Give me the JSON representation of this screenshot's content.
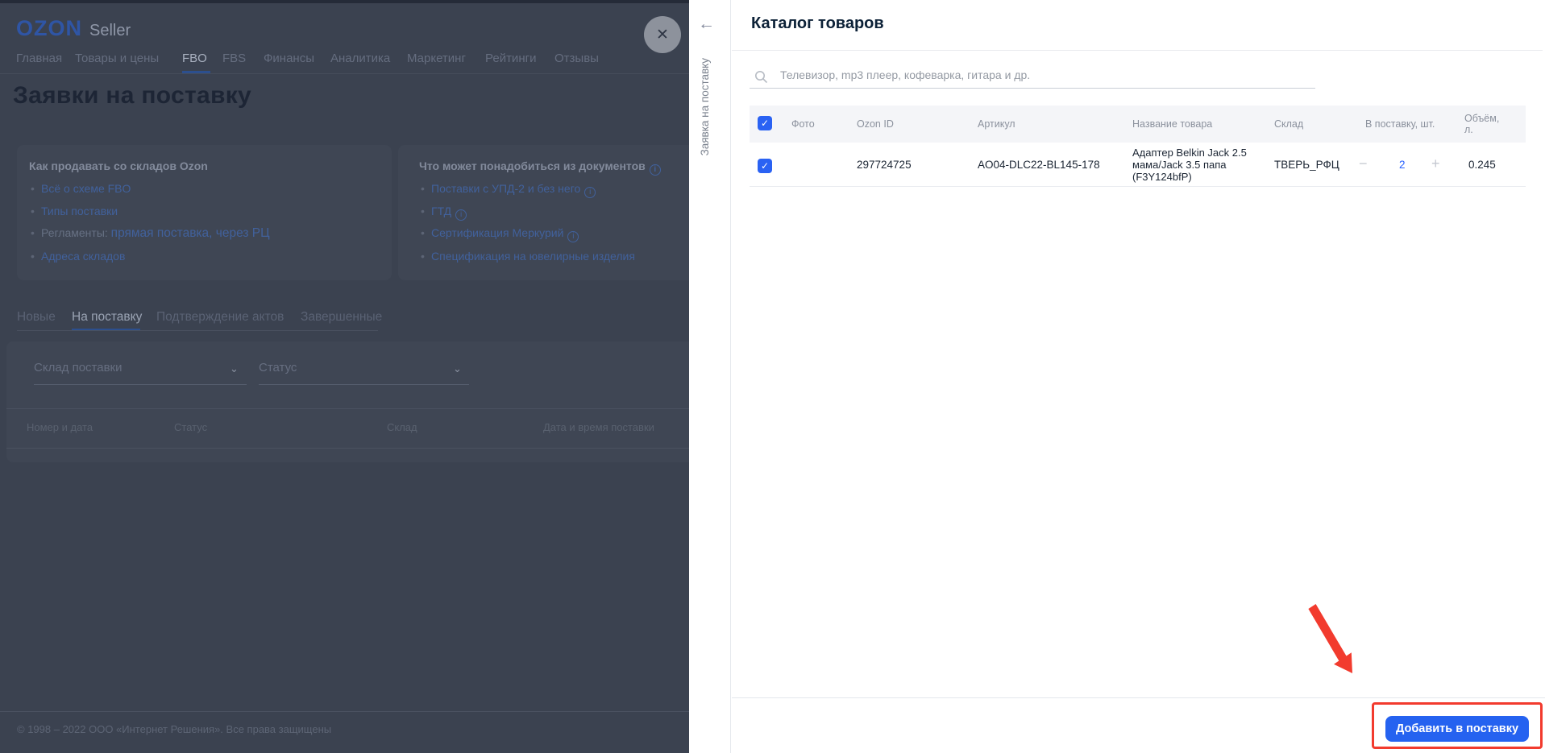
{
  "brand": {
    "ozon": "OZON",
    "seller": "Seller"
  },
  "nav": {
    "items": [
      {
        "label": "Главная"
      },
      {
        "label": "Товары и цены"
      },
      {
        "label": "FBO"
      },
      {
        "label": "FBS"
      },
      {
        "label": "Финансы"
      },
      {
        "label": "Аналитика"
      },
      {
        "label": "Маркетинг"
      },
      {
        "label": "Рейтинги"
      },
      {
        "label": "Отзывы"
      }
    ],
    "active": "FBO"
  },
  "page": {
    "title": "Заявки на поставку",
    "help_cards": [
      {
        "title": "Как продавать со складов Ozon",
        "links": [
          {
            "text": "Всё о схеме FBO"
          },
          {
            "text": "Типы поставки"
          },
          {
            "prefix": "Регламенты:",
            "text": "прямая поставка, через РЦ"
          },
          {
            "text": "Адреса складов"
          }
        ]
      },
      {
        "title": "Что может понадобиться из документов",
        "links": [
          {
            "text": "Поставки с УПД-2 и без него"
          },
          {
            "text": "ГТД"
          },
          {
            "text": "Сертификация Меркурий"
          },
          {
            "text": "Спецификация на ювелирные изделия"
          }
        ]
      }
    ],
    "tabs": [
      {
        "label": "Новые"
      },
      {
        "label": "На поставку"
      },
      {
        "label": "Подтверждение актов"
      },
      {
        "label": "Завершенные"
      }
    ],
    "active_tab": "На поставку",
    "filters": {
      "warehouse_placeholder": "Склад поставки",
      "status_placeholder": "Статус"
    },
    "table_headers": [
      "Номер и дата",
      "Статус",
      "Склад",
      "Дата и время поставки"
    ],
    "footer": "© 1998 – 2022 ООО «Интернет Решения». Все права защищены"
  },
  "drawer": {
    "rail_label": "Заявка на поставку",
    "title": "Каталог товаров",
    "search_placeholder": "Телевизор, mp3 плеер, кофеварка, гитара и др.",
    "table": {
      "headers": [
        "Фото",
        "Ozon ID",
        "Артикул",
        "Название товара",
        "Склад",
        "В поставку, шт.",
        "Объём, л."
      ],
      "row": {
        "ozon_id": "297724725",
        "article": "AO04-DLC22-BL145-178",
        "name": "Адаптер Belkin Jack 2.5 мама/Jack 3.5 папа (F3Y124bfP)",
        "warehouse": "ТВЕРЬ_РФЦ",
        "qty": "2",
        "minus": "−",
        "plus": "+",
        "volume": "0.245"
      }
    },
    "submit_label": "Добавить в поставку",
    "close_glyph": "✕",
    "back_glyph": "←",
    "check_glyph": "✓",
    "chevron_glyph": "⌄"
  },
  "colors": {
    "accent_blue": "#2962ff",
    "annotation_red": "#f23b2e"
  }
}
